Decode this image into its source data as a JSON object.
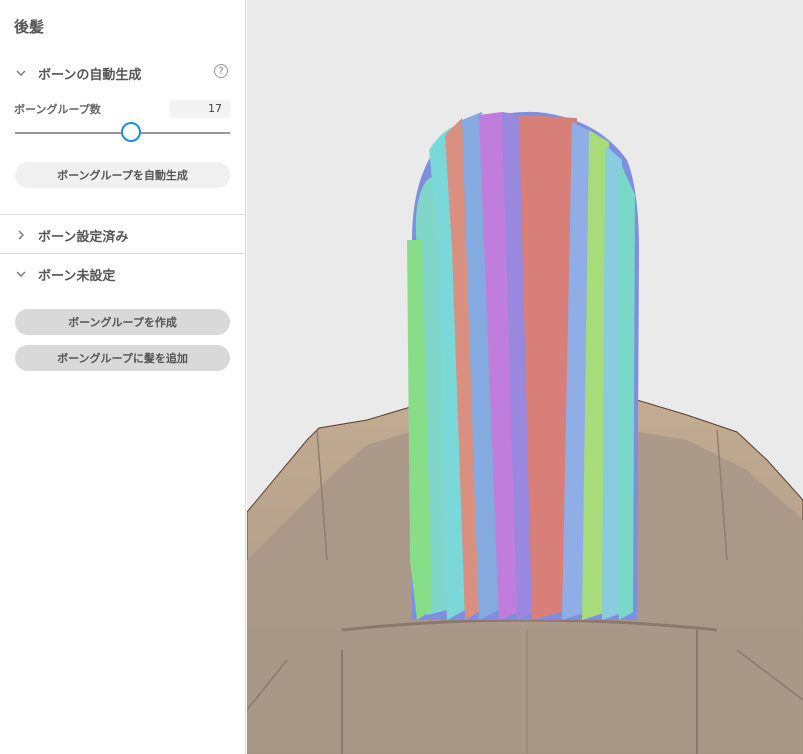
{
  "panel": {
    "title": "後髪",
    "auto_section": {
      "label": "ボーンの自動生成",
      "help_icon": "?",
      "group_count_label": "ボーングループ数",
      "group_count_value": "17",
      "slider_fraction": 0.55,
      "auto_button": "ボーングループを自動生成"
    },
    "configured_section": {
      "label": "ボーン設定済み"
    },
    "unconfigured_section": {
      "label": "ボーン未設定",
      "create_button": "ボーングループを作成",
      "add_button": "ボーングループに髪を追加"
    }
  },
  "colors": {
    "accent": "#1e8fd6",
    "viewport_bg": "#eaeaea",
    "body_tan": "#a89684"
  }
}
